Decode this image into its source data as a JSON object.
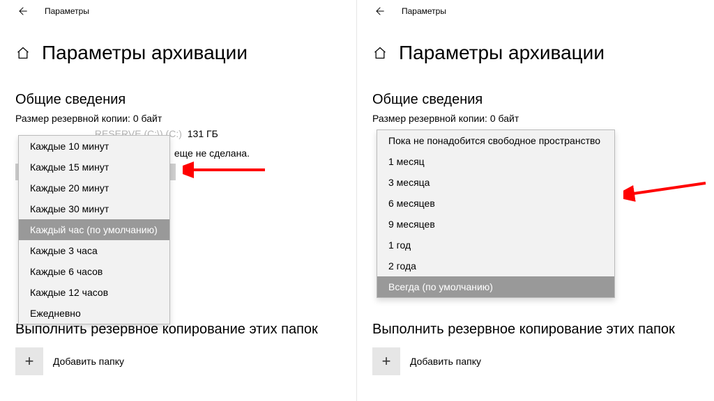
{
  "titlebar": {
    "label": "Параметры"
  },
  "page": {
    "title": "Параметры архивации"
  },
  "overview": {
    "heading": "Общие сведения",
    "backup_size": "Размер резервной копии: 0 байт",
    "drive_row_head": "RESERVE (C:\\) (C:)",
    "drive_row_tail": "131 ГБ",
    "not_done": "еще не сделана."
  },
  "folders": {
    "heading": "Выполнить резервное копирование этих папок",
    "add_label": "Добавить папку"
  },
  "left_menu": {
    "items": [
      "Каждые 10 минут",
      "Каждые 15 минут",
      "Каждые 20 минут",
      "Каждые 30 минут",
      "Каждый час (по умолчанию)",
      "Каждые 3 часа",
      "Каждые 6 часов",
      "Каждые 12 часов",
      "Ежедневно"
    ],
    "selected_index": 4
  },
  "right_menu": {
    "items": [
      "Пока не понадобится свободное пространство",
      "1 месяц",
      "3 месяца",
      "6 месяцев",
      "9 месяцев",
      "1 год",
      "2 года",
      "Всегда (по умолчанию)"
    ],
    "selected_index": 7
  }
}
